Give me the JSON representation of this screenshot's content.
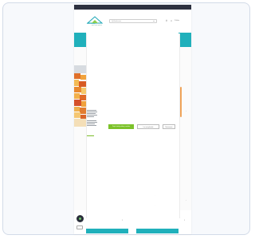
{
  "logo": {
    "name": "DomRealtor",
    "tagline": "your home partner"
  },
  "header": {
    "search_placeholder": "Vyhľadávanie",
    "login_label": "Prihlás"
  },
  "consent": {
    "accept_label": "Prijať všetky súbory cookies",
    "necessary_label": "Len nevyhnutné",
    "settings_label": "Nastavenie"
  },
  "footer": {
    "left_label": "",
    "left_count": "1",
    "right_label": "",
    "right_count": "1",
    "left_button_label": "",
    "right_button_label": ""
  },
  "colors": {
    "accent_teal": "#20b0bb",
    "accept_green": "#7cc22a",
    "scroll_orange": "#f0a45a",
    "topbar_dark": "#2d3140"
  },
  "icons": {
    "search": "search-icon",
    "user": "user-icon",
    "menu": "menu-icon",
    "chat": "chat-icon"
  }
}
